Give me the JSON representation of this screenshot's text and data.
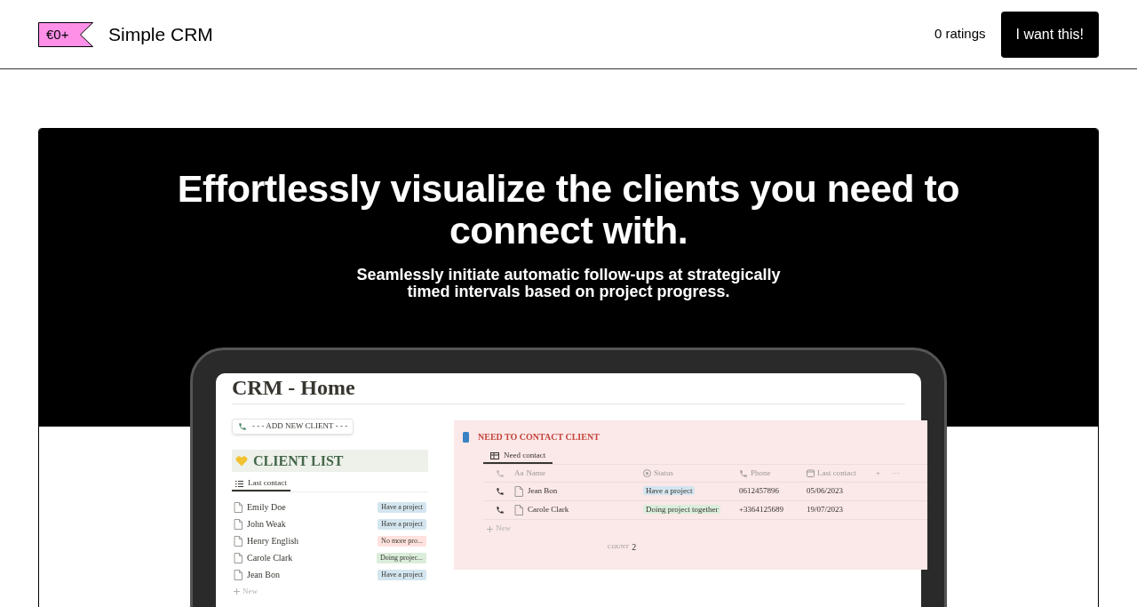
{
  "header": {
    "price": "€0+",
    "title": "Simple CRM",
    "ratings": "0 ratings",
    "buy_button": "I want this!"
  },
  "hero": {
    "headline": "Effortlessly visualize the clients you need to connect with.",
    "subheadline": "Seamlessly initiate automatic follow-ups at strategically timed intervals based on project progress."
  },
  "notion": {
    "page_title": "CRM - Home",
    "add_button": "- - - ADD NEW CLIENT - - -",
    "client_list": {
      "title": "CLIENT LIST",
      "view_tab": "Last contact",
      "rows": [
        {
          "name": "Emily Doe",
          "status": "Have a project",
          "color": "#d3e5ef"
        },
        {
          "name": "John Weak",
          "status": "Have a project",
          "color": "#d3e5ef"
        },
        {
          "name": "Henry English",
          "status": "No more pro...",
          "color": "#ffe2dd"
        },
        {
          "name": "Carole Clark",
          "status": "Doing projec...",
          "color": "#dbeddb"
        },
        {
          "name": "Jean Bon",
          "status": "Have a project",
          "color": "#d3e5ef"
        }
      ],
      "new": "New"
    },
    "contact_panel": {
      "title": "NEED TO CONTACT CLIENT",
      "view_tab": "Need contact",
      "columns": [
        "Aa",
        "Name",
        "Status",
        "Phone",
        "Last contact",
        "+",
        "···"
      ],
      "rows": [
        {
          "name": "Jean Bon",
          "status": "Have a project",
          "color": "#d3e5ef",
          "phone": "0612457896",
          "last_contact": "05/06/2023"
        },
        {
          "name": "Carole Clark",
          "status": "Doing project together",
          "color": "#dbeddb",
          "phone": "+3364125689",
          "last_contact": "19/07/2023"
        }
      ],
      "new": "New",
      "count_label": "COUNT",
      "count": "2"
    }
  }
}
